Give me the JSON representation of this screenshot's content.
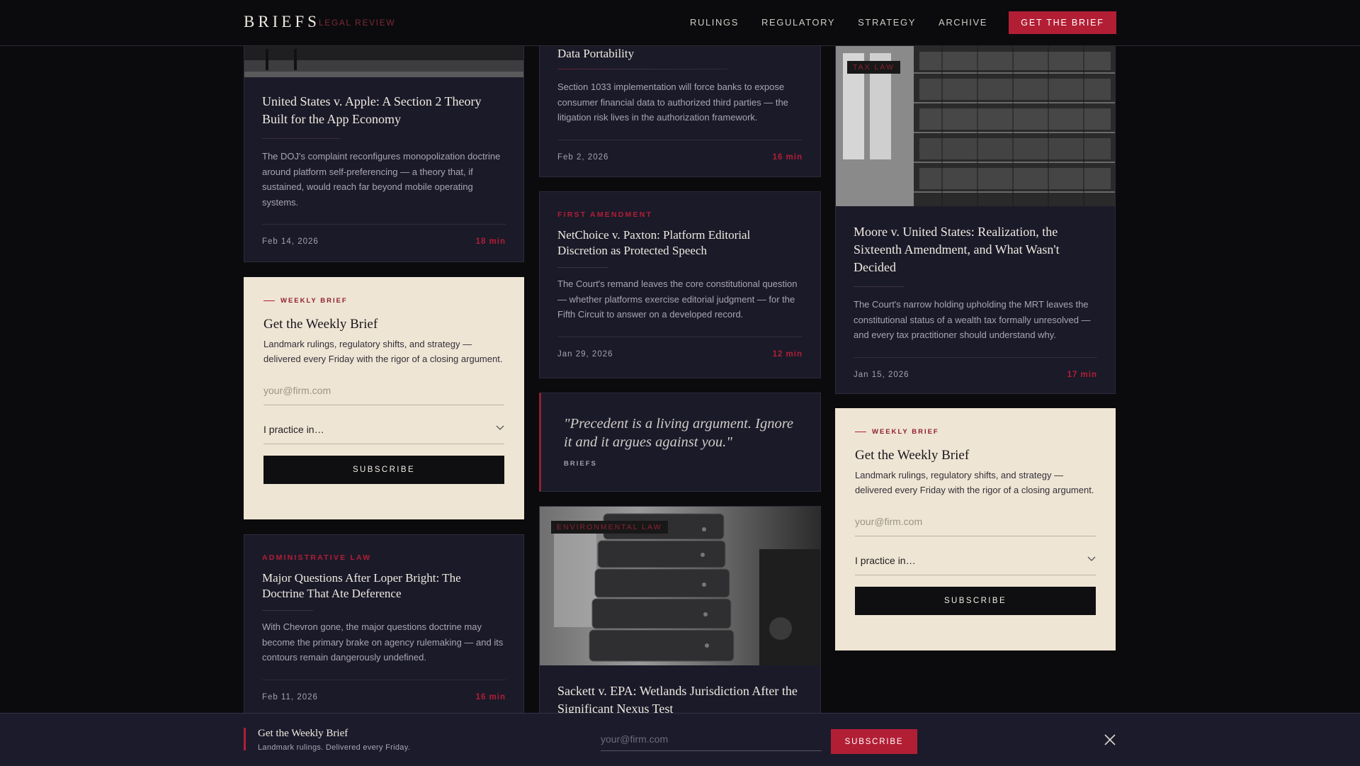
{
  "nav": {
    "logo": "BRIEFS",
    "logo_sub": "LEGAL REVIEW",
    "links": [
      "RULINGS",
      "REGULATORY",
      "STRATEGY",
      "ARCHIVE"
    ],
    "cta": "GET THE BRIEF"
  },
  "col1": {
    "card1": {
      "title": "United States v. Apple: A Section 2 Theory Built for the App Economy",
      "excerpt": "The DOJ's complaint reconfigures monopolization doctrine around platform self-preferencing — a theory that, if sustained, would reach far beyond mobile operating systems.",
      "date": "Feb 14, 2026",
      "read": "18 min"
    },
    "card2": {
      "category": "ADMINISTRATIVE LAW",
      "title": "Major Questions After Loper Bright: The Doctrine That Ate Deference",
      "excerpt": "With Chevron gone, the major questions doctrine may become the primary brake on agency rulemaking — and its contours remain dangerously undefined.",
      "date": "Feb 11, 2026",
      "read": "16 min"
    }
  },
  "col2": {
    "card1": {
      "title": "Data Portability",
      "excerpt": "Section 1033 implementation will force banks to expose consumer financial data to authorized third parties — the litigation risk lives in the authorization framework.",
      "date": "Feb 2, 2026",
      "read": "16 min"
    },
    "card2": {
      "category": "FIRST AMENDMENT",
      "title": "NetChoice v. Paxton: Platform Editorial Discretion as Protected Speech",
      "excerpt": "The Court's remand leaves the core constitutional question — whether platforms exercise editorial judgment — for the Fifth Circuit to answer on a developed record.",
      "date": "Jan 29, 2026",
      "read": "12 min"
    },
    "quote": {
      "text": "\"Precedent is a living argument. Ignore it and it argues against you.\"",
      "source": "BRIEFS"
    },
    "card3": {
      "tag": "ENVIRONMENTAL LAW",
      "title": "Sackett v. EPA: Wetlands Jurisdiction After the Significant Nexus Test"
    }
  },
  "col3": {
    "card1": {
      "tag": "TAX LAW",
      "title": "Moore v. United States: Realization, the Sixteenth Amendment, and What Wasn't Decided",
      "excerpt": "The Court's narrow holding upholding the MRT leaves the constitutional status of a wealth tax formally unresolved — and every tax practitioner should understand why.",
      "date": "Jan 15, 2026",
      "read": "17 min"
    }
  },
  "newsletter": {
    "eyebrow": "WEEKLY BRIEF",
    "title": "Get the Weekly Brief",
    "description": "Landmark rulings, regulatory shifts, and strategy — delivered every Friday with the rigor of a closing argument.",
    "email_placeholder": "your@firm.com",
    "practice_label": "I practice in…",
    "button": "SUBSCRIBE"
  },
  "sticky": {
    "title": "Get the Weekly Brief",
    "subtitle": "Landmark rulings. Delivered every Friday.",
    "email_placeholder": "your@firm.com",
    "button": "SUBSCRIBE"
  },
  "icons": {
    "chevron": "chevron-down-icon",
    "close": "close-icon"
  }
}
